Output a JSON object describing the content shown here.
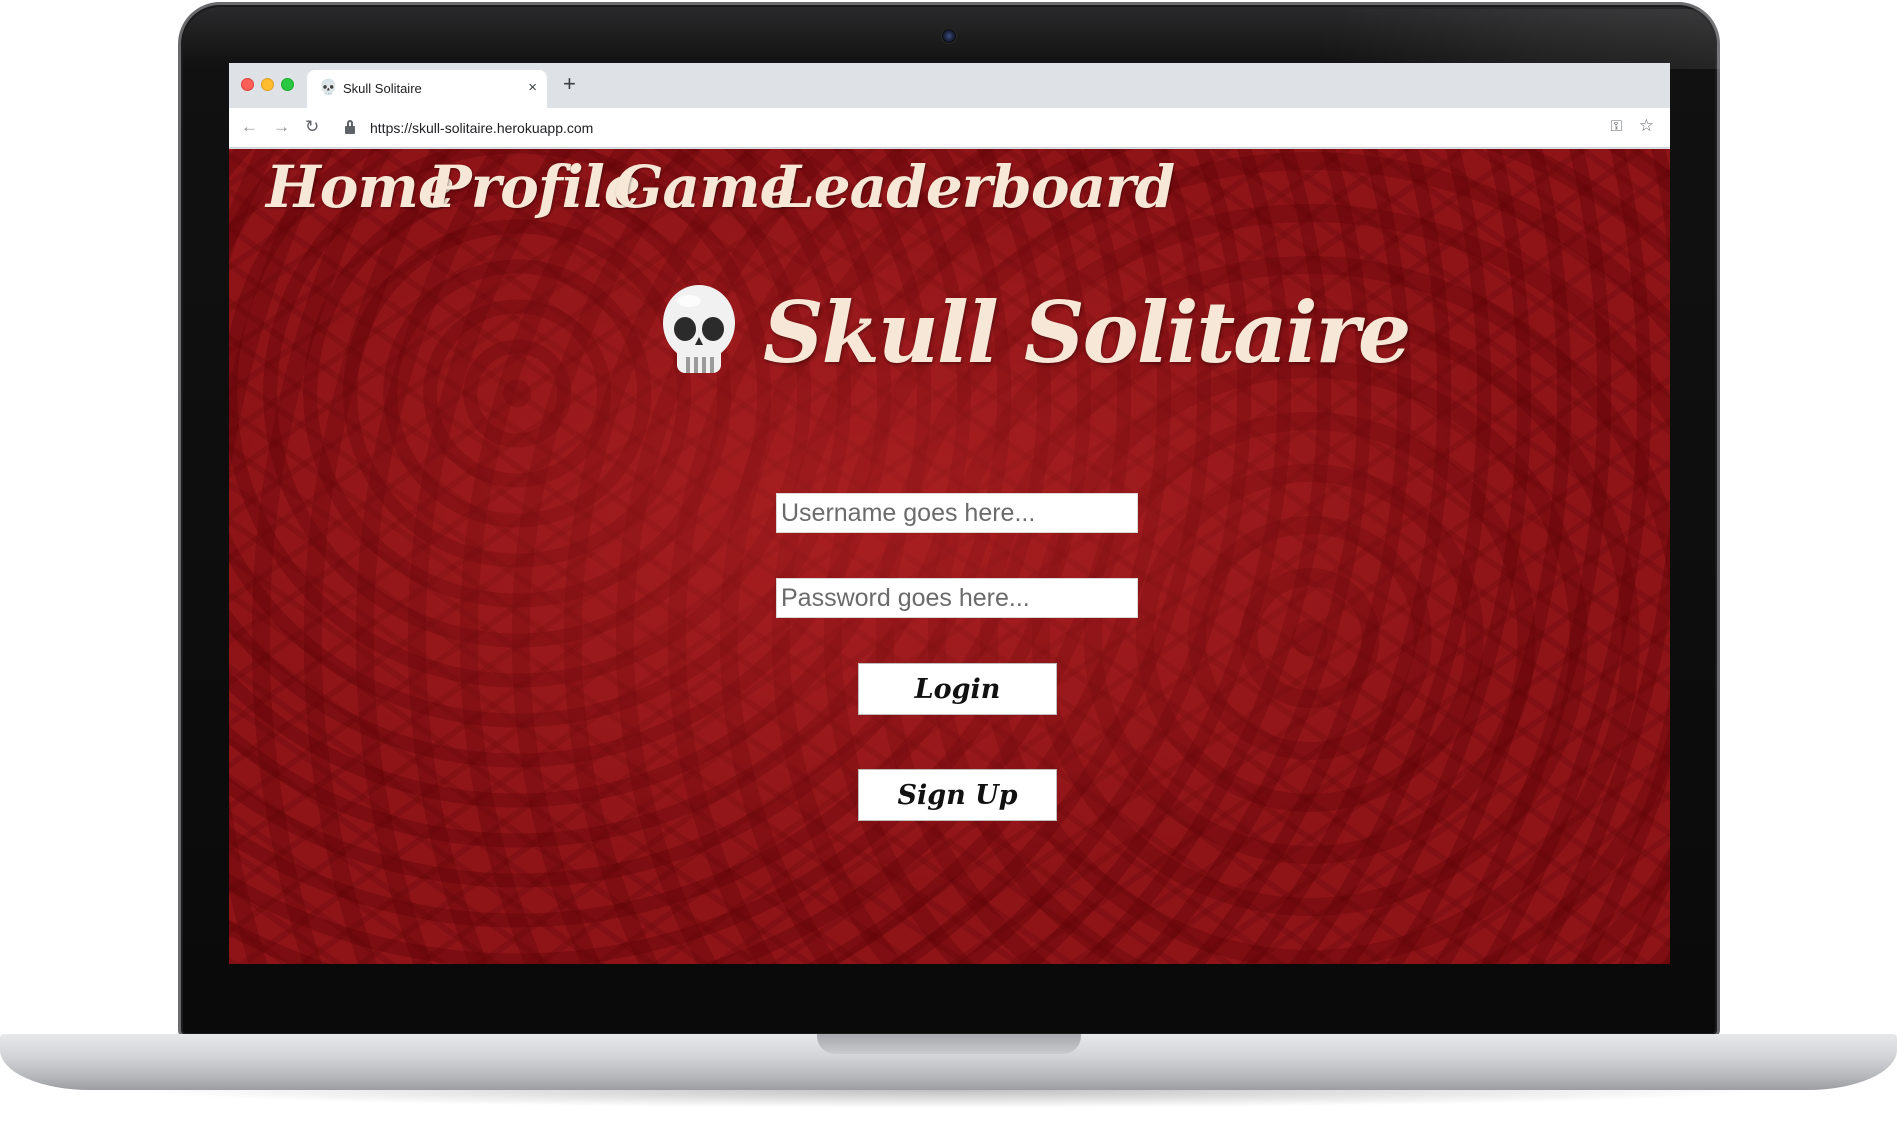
{
  "browser": {
    "tab": {
      "title": "Skull Solitaire",
      "favicon": "skull-icon",
      "close_label": "×"
    },
    "new_tab_label": "+",
    "toolbar": {
      "back_label": "←",
      "forward_label": "→",
      "reload_label": "↻",
      "url": "https://skull-solitaire.herokuapp.com",
      "key_label": "⚿",
      "star_label": "☆"
    }
  },
  "site": {
    "nav": [
      "Home",
      "Profile",
      "Game",
      "Leaderboard"
    ],
    "title": "Skull Solitaire",
    "logo_icon": "skull-icon",
    "background_color": "#8e1418",
    "text_color": "#f7e7d6"
  },
  "login_form": {
    "username_placeholder": "Username goes here...",
    "password_placeholder": "Password goes here...",
    "login_label": "Login",
    "signup_label": "Sign Up"
  }
}
